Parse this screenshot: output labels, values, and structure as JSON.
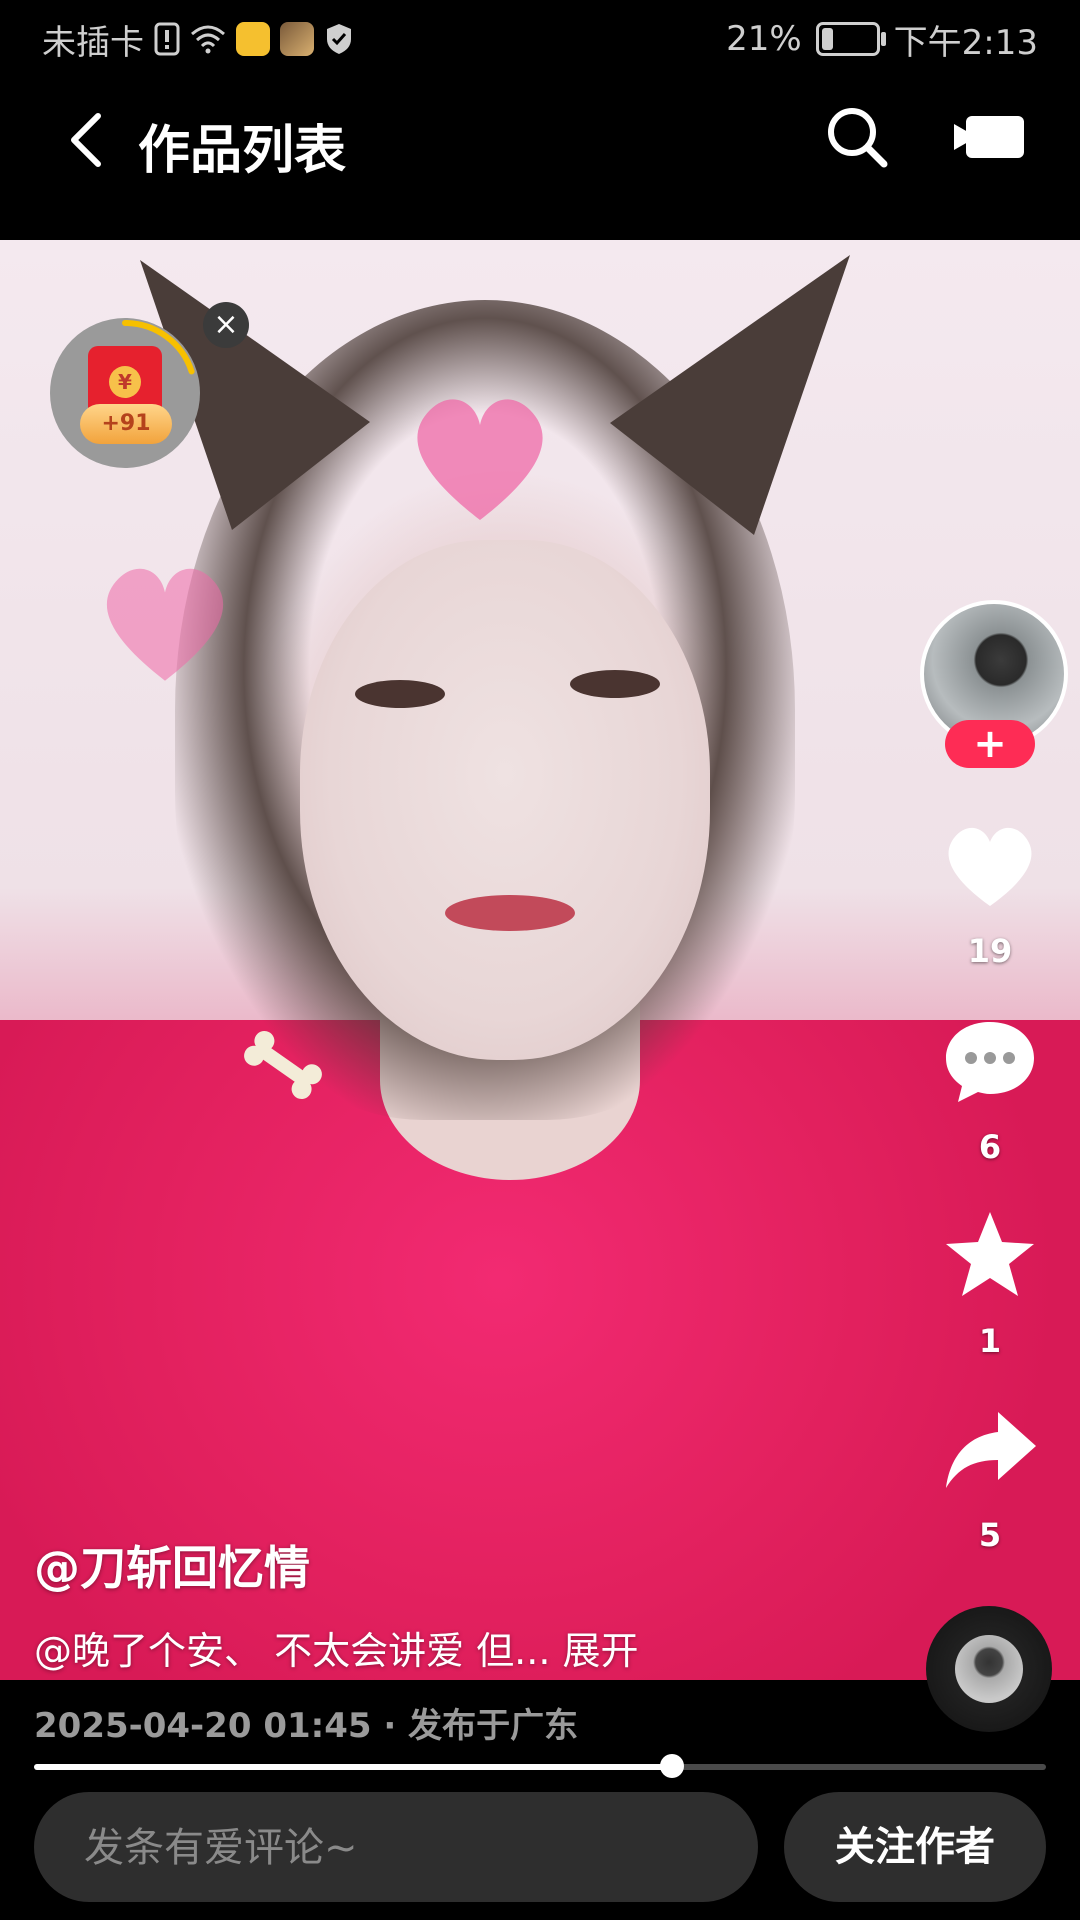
{
  "status_bar": {
    "carrier": "未插卡",
    "battery": "21%",
    "battery_level": 0.21,
    "time": "下午2:13"
  },
  "header": {
    "title": "作品列表",
    "back_icon": "chevron-left-icon",
    "search_icon": "search-icon",
    "camera_icon": "video-camera-icon"
  },
  "red_packet": {
    "badge": "+91",
    "coin_symbol": "¥",
    "close": "×",
    "progress": 0.2
  },
  "actions": {
    "follow_plus": "+",
    "likes": "19",
    "comments": "6",
    "favorites": "1",
    "shares": "5"
  },
  "video": {
    "author": "@刀斩回忆情",
    "description": "@晚了个安、 不太会讲爱 但... 展开",
    "meta": "2025-04-20 01:45 · 发布于广东",
    "progress": 0.63
  },
  "bottom_bar": {
    "comment_placeholder": "发条有爱评论~",
    "follow_label": "关注作者"
  },
  "colors": {
    "accent": "#fe2c55",
    "background": "#000000"
  }
}
